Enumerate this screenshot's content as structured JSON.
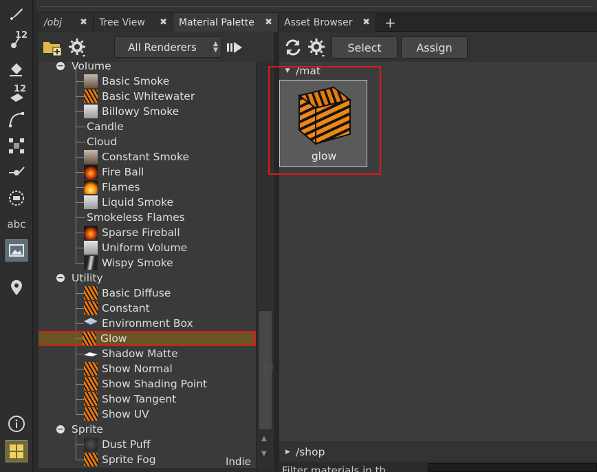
{
  "tabs": [
    {
      "label": "/obj",
      "closable": true
    },
    {
      "label": "Tree View",
      "closable": true
    },
    {
      "label": "Material Palette",
      "closable": true,
      "active": true
    },
    {
      "label": "Asset Browser",
      "closable": true
    }
  ],
  "tab_close_glyph": "✖",
  "add_tab_glyph": "+",
  "shelf": {
    "badge_12": "12",
    "badge_12b": "12",
    "abc_label": "abc"
  },
  "left_toolbar": {
    "renderer_filter": "All Renderers"
  },
  "tree": {
    "categories": [
      {
        "label": "Volume",
        "items": [
          {
            "label": "Basic Smoke",
            "icon": "smoke"
          },
          {
            "label": "Basic Whitewater",
            "icon": "tiger"
          },
          {
            "label": "Billowy Smoke",
            "icon": "grey"
          },
          {
            "label": "Candle",
            "icon": ""
          },
          {
            "label": "Cloud",
            "icon": ""
          },
          {
            "label": "Constant Smoke",
            "icon": "smoke"
          },
          {
            "label": "Fire Ball",
            "icon": "fire"
          },
          {
            "label": "Flames",
            "icon": "flame"
          },
          {
            "label": "Liquid Smoke",
            "icon": "grey"
          },
          {
            "label": "Smokeless Flames",
            "icon": ""
          },
          {
            "label": "Sparse Fireball",
            "icon": "fire"
          },
          {
            "label": "Uniform Volume",
            "icon": "grey"
          },
          {
            "label": "Wispy Smoke",
            "icon": "wisp"
          }
        ]
      },
      {
        "label": "Utility",
        "items": [
          {
            "label": "Basic Diffuse",
            "icon": "tiger"
          },
          {
            "label": "Constant",
            "icon": "tiger"
          },
          {
            "label": "Environment Box",
            "icon": "envbox"
          },
          {
            "label": "Glow",
            "icon": "tiger",
            "selected": true
          },
          {
            "label": "Shadow Matte",
            "icon": "matte"
          },
          {
            "label": "Show Normal",
            "icon": "tiger"
          },
          {
            "label": "Show Shading Point",
            "icon": "tiger"
          },
          {
            "label": "Show Tangent",
            "icon": "tiger"
          },
          {
            "label": "Show UV",
            "icon": "tiger"
          }
        ]
      },
      {
        "label": "Sprite",
        "items": [
          {
            "label": "Dust Puff",
            "icon": "dust"
          },
          {
            "label": "Sprite Fog",
            "icon": "tiger"
          }
        ]
      }
    ]
  },
  "license_label": "Indie",
  "right_toolbar": {
    "select_label": "Select",
    "assign_label": "Assign"
  },
  "gallery": {
    "mat_path": "/mat",
    "materials": [
      {
        "label": "glow"
      }
    ],
    "shop_path": "/shop"
  },
  "filter_text": "Filter materials in th..."
}
